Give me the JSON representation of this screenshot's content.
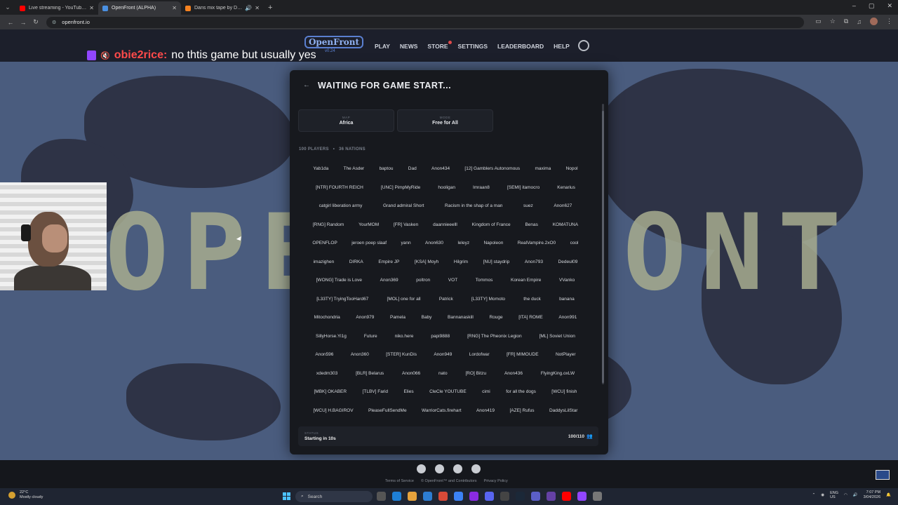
{
  "browser": {
    "tabs": [
      {
        "title": "Live streaming - YouTube Studio",
        "favicon_color": "#ff0000"
      },
      {
        "title": "OpenFront (ALPHA)",
        "favicon_color": "#4a90e2"
      },
      {
        "title": "Dans mix tape by Daniel D",
        "favicon_color": "#f58220"
      }
    ],
    "url": "openfront.io"
  },
  "site": {
    "logo": "OpenFront",
    "version": "v0.24",
    "nav": [
      "PLAY",
      "NEWS",
      "STORE",
      "SETTINGS",
      "LEADERBOARD",
      "HELP"
    ]
  },
  "chat": {
    "user": "obie2rice:",
    "message": "no thtis game but usually yes"
  },
  "background_letters": [
    "OPE",
    "ONT"
  ],
  "modal": {
    "title": "WAITING FOR GAME START...",
    "map_label": "MAP",
    "map_value": "Africa",
    "mode_label": "MODE",
    "mode_value": "Free for All",
    "players_count": "100 PLAYERS",
    "separator": "•",
    "nations_count": "36 NATIONS",
    "rows": [
      [
        "Yab1da",
        "The Asder",
        "baptou",
        "Dad",
        "Anon434",
        "[12] Gamblers Autonomous",
        "maxima",
        "Nopol"
      ],
      [
        "[NTR] FOURTH REICH",
        "[UNC] PimpMyRide",
        "hooligan",
        "Imraan8",
        "[SEMI] itamocro",
        "Kenarius"
      ],
      [
        "catgirl liberation army",
        "Grand admiral Short",
        "Racism in the shap of a man",
        "suez",
        "Anon627"
      ],
      [
        "[RNG] Random",
        "YourMOM",
        "[FR] Vasken",
        "daannieeelll",
        "Kingdom of France",
        "Benas",
        "KOMATUNA"
      ],
      [
        "OPENFLOP",
        "jeroen poep slaaf",
        "yann",
        "Anon630",
        "leleyz",
        "Napoleon",
        "RealVampire.2xO0",
        "cool"
      ],
      [
        "imazighen",
        "DIRKA",
        "Empire JP",
        "[KSA] Moyh",
        "Hilgrim",
        "[NU] staydrip",
        "Anon793",
        "Dedeul09"
      ],
      [
        "[WONG] Trade is Love",
        "Anon369",
        "poltron",
        "VOT",
        "Tommos",
        "Korean Empire",
        "VVanko"
      ],
      [
        "[L33TY] TryingTooHard67",
        "[MOL] one for all",
        "Patrick",
        "[L33TY] Momoto",
        "the duck",
        "banana"
      ],
      [
        "Mitochondria",
        "Anon979",
        "Pamela",
        "Baby",
        "Bannanaskill",
        "Rouge",
        "[ITA] ROME",
        "Anon991"
      ],
      [
        "SillyHorse.Yi1g",
        "Future",
        "niko.here",
        "papi9888",
        "[RNG] The Pheonix Legion",
        "[ML] Soviet Union"
      ],
      [
        "Anon596",
        "Anon360",
        "[STER] KunDis",
        "Anon949",
        "Lordofwar",
        "[FR] MIMOUDE",
        "NotPlayer"
      ],
      [
        "xdedm303",
        "[BLR] Belarus",
        "Anon066",
        "nato",
        "[RO] Bitzu",
        "Anon436",
        "FlyingKing.oxLW"
      ],
      [
        "[MBK] OKABER",
        "[TLBV] Farid",
        "Elies",
        "CleCle YOUTUBE",
        "cimi",
        "for all the dogs",
        "[WCU] finish"
      ],
      [
        "[WCU] H.BAGIROV",
        "PleaseFullSendMe",
        "WarriorCats.firehart",
        "Anon419",
        "[AZE] Rufus",
        "DaddysLilStar"
      ]
    ],
    "status_label": "STATUS",
    "status_value": "Starting in 10s",
    "player_ratio": "100/110"
  },
  "footer": {
    "links": [
      "Terms of Service",
      "© OpenFront™ and Contributors",
      "Privacy Policy"
    ]
  },
  "taskbar": {
    "temp": "22°C",
    "weather": "Mostly cloudy",
    "search_placeholder": "Search",
    "lang": "ENG",
    "region": "US",
    "time": "7:07 PM",
    "date": "3/04/2026"
  }
}
